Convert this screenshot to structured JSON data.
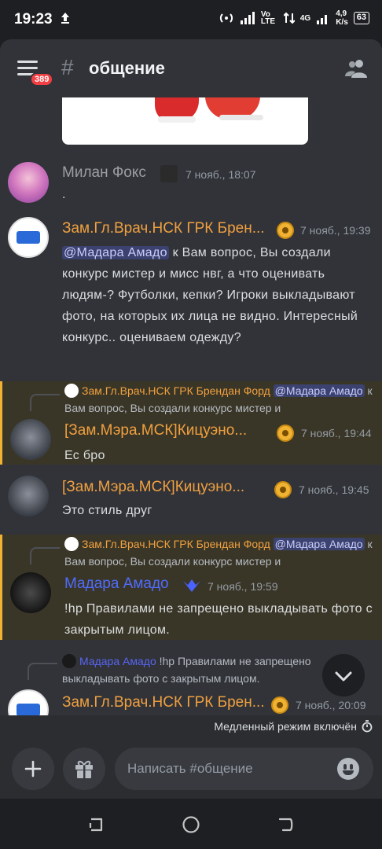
{
  "status_bar": {
    "time": "19:23",
    "network_speed": "4,9",
    "network_unit": "K/s",
    "battery": "63",
    "net_type": "4G",
    "volte": "Vo LTE"
  },
  "header": {
    "unread_badge": "389",
    "hash_symbol": "#",
    "channel_name": "общение"
  },
  "messages": [
    {
      "author": "Милан Фокс",
      "time": "7 нояб., 18:07",
      "text": "."
    },
    {
      "author": "Зам.Гл.Врач.НСК ГРК Брен...",
      "time": "7 нояб., 19:39",
      "mention": "@Мадара Амадо",
      "text": " к Вам вопрос, Вы создали конкурс мистер и мисс нвг, а что оценивать людям-? Футболки, кепки? Игроки выкладывают фото, на которых их лица не видно. Интересный конкурс.. оцениваем одежду?"
    },
    {
      "reply_author": "Зам.Гл.Врач.НСК ГРК Брендан Форд",
      "reply_mention": "@Мадара Амадо",
      "reply_text": " к Вам вопрос, Вы создали конкурс мистер и",
      "author": "[Зам.Мэра.МСК]Кицуэно...",
      "time": "7 нояб., 19:44",
      "text": "Ес бро"
    },
    {
      "author": "[Зам.Мэра.МСК]Кицуэно...",
      "time": "7 нояб., 19:45",
      "text": "Это стиль друг"
    },
    {
      "reply_author": "Зам.Гл.Врач.НСК ГРК Брендан Форд",
      "reply_mention": "@Мадара Амадо",
      "reply_text": " к Вам вопрос, Вы создали конкурс мистер и",
      "author": "Мадара Амадо",
      "time": "7 нояб., 19:59",
      "text": "!hp Правилами не запрещено выкладывать фото с закрытым лицом."
    },
    {
      "reply_author": "Мадара Амадо",
      "reply_text": " !hp Правилами не запрещено выкладывать фото с закрытым лицом.",
      "author": "Зам.Гл.Врач.НСК ГРК Брен...",
      "time": "7 нояб., 20:09"
    }
  ],
  "slow_mode": "Медленный режим включён",
  "composer": {
    "placeholder": "Написать #общение"
  },
  "colors": {
    "background": "#313338",
    "highlight": "#3a3627",
    "highlight_border": "#f0b232",
    "role_orange": "#f0a040",
    "role_blue": "#5865f2",
    "mention_bg": "#3c4270"
  }
}
